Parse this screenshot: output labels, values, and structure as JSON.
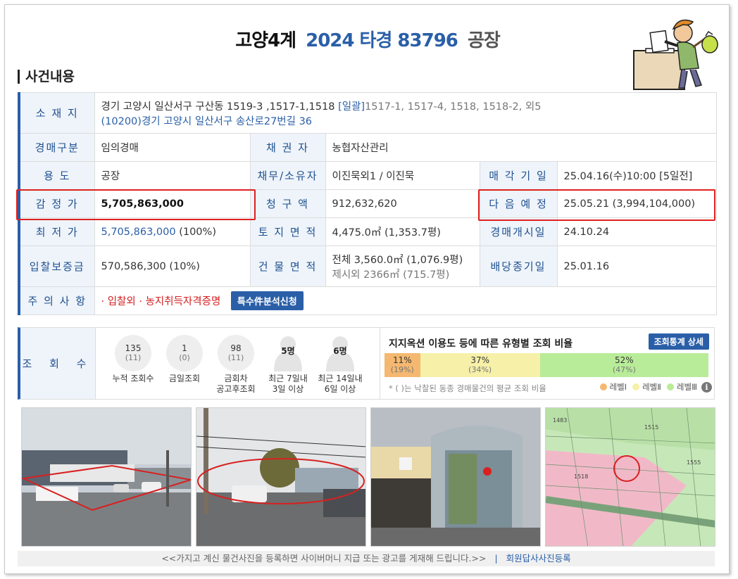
{
  "header": {
    "court": "고양4계",
    "case_number": "2024 타경 83796",
    "kind": "공장"
  },
  "section_title": "사건내용",
  "info": {
    "location_label": "소 재 지",
    "location_line1": "경기 고양시 일산서구 구산동 1519-3 ,1517-1,1518",
    "location_bulk": "[일괄]",
    "location_bulk_lots": "1517-1, 1517-4, 1518, 1518-2, 외5",
    "location_line2": "(10200)경기 고양시 일산서구  송산로27번길  36",
    "auction_type_label": "경매구분",
    "auction_type": "임의경매",
    "creditor_label": "채 권 자",
    "creditor": "농협자산관리",
    "usage_label": "용     도",
    "usage": "공장",
    "debtor_label": "채무/소유자",
    "debtor": "이진묵외1 / 이진묵",
    "sale_date_label": "매 각 기 일",
    "sale_date": "25.04.16(수)10:00",
    "sale_date_dday": "[5일전]",
    "appraisal_label": "감 정 가",
    "appraisal": "5,705,863,000",
    "claim_label": "청 구 액",
    "claim": "912,632,620",
    "next_label": "다 음 예 정",
    "next": "25.05.21 (3,994,104,000)",
    "min_price_label": "최 저 가",
    "min_price": "5,705,863,000",
    "min_price_pct": "(100%)",
    "land_area_label": "토 지 면 적",
    "land_area": "4,475.0㎡ (1,353.7평)",
    "auction_start_label": "경매개시일",
    "auction_start": "24.10.24",
    "deposit_label": "입찰보증금",
    "deposit": "570,586,300 (10%)",
    "building_area_label": "건 물 면 적",
    "building_area": "전체 3,560.0㎡ (1,076.9평)",
    "building_area_excl": "제시외 2366㎡ (715.7평)",
    "dividend_label": "배당종기일",
    "dividend": "25.01.16",
    "notice_label": "주 의 사 항",
    "notice": "· 입찰외 · 농지취득자격증명",
    "analysis_button": "특수件분석신청"
  },
  "views": {
    "label": "조 회 수",
    "stats": [
      {
        "value": "135",
        "sub": "(11)",
        "caption": "누적 조회수"
      },
      {
        "value": "1",
        "sub": "(0)",
        "caption": "금일조회"
      },
      {
        "value": "98",
        "sub": "(11)",
        "caption": "금회차\n공고후조회"
      }
    ],
    "persons": [
      {
        "value": "5명",
        "caption1": "최근 7일내",
        "caption2": "3일 이상"
      },
      {
        "value": "6명",
        "caption1": "최근 14일내",
        "caption2": "6일 이상"
      }
    ]
  },
  "ratio": {
    "title": "지지옥션 이용도 등에 따른 유형별 조회 비율",
    "button": "조회통계 상세",
    "segments": [
      {
        "value": "11%",
        "sub": "(19%)",
        "fraction": 0.11,
        "color": "#f4b870"
      },
      {
        "value": "37%",
        "sub": "(34%)",
        "fraction": 0.37,
        "color": "#f6f0a8"
      },
      {
        "value": "52%",
        "sub": "(47%)",
        "fraction": 0.52,
        "color": "#b8ec98"
      }
    ],
    "note": "* ( )는 낙찰된 동종 경매물건의 평균 조회 비율",
    "legend": [
      "레벨Ⅰ",
      "레벨Ⅱ",
      "레벨Ⅲ"
    ]
  },
  "footer": {
    "text": "<<가지고 계신 물건사진을 등록하면 사이버머니 지급 또는 광고를 게재해 드립니다.>>",
    "separator": "|",
    "register": "회원답사사진등록"
  }
}
